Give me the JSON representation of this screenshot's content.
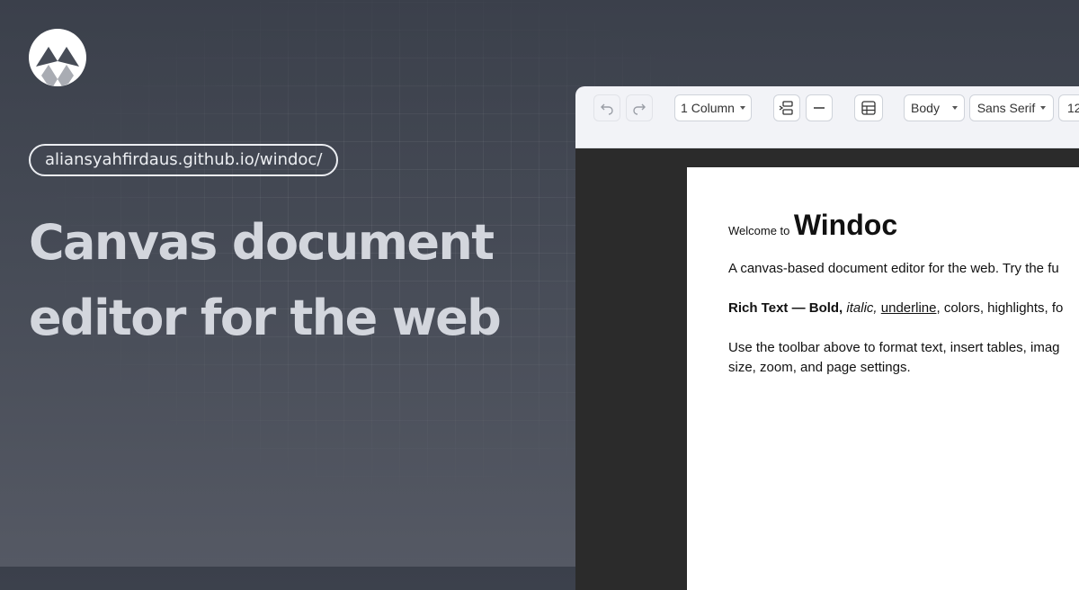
{
  "brand": {
    "logo_icon": "windoc-logo-icon"
  },
  "url": "aliansyahfirdaus.github.io/windoc/",
  "headline": {
    "line1": "Canvas document",
    "line2": "editor for the web"
  },
  "toolbar": {
    "undo_icon": "undo-icon",
    "redo_icon": "redo-icon",
    "columns_label": "1 Column",
    "page_break_icon": "page-break-icon",
    "separator_icon": "horizontal-rule-icon",
    "table_icon": "table-icon",
    "style_label": "Body",
    "font_label": "Sans Serif",
    "size_label": "12"
  },
  "document": {
    "title_prefix": "Welcome to",
    "title": "Windoc",
    "line1": "A canvas-based document editor for the web. Try the fu",
    "rich_label": "Rich Text — Bold,",
    "rich_italic": "italic,",
    "rich_underline": "underline",
    "rich_rest": ", colors, highlights, fo",
    "line3a": "Use the toolbar above to format text, insert tables, imag",
    "line3b": "size, zoom, and page settings."
  },
  "colors": {
    "background_top": "#3b404b",
    "background_bottom": "#555964",
    "headline": "#d3d6dd",
    "toolbar": "#f2f3f7",
    "canvas": "#2b2b2b"
  }
}
